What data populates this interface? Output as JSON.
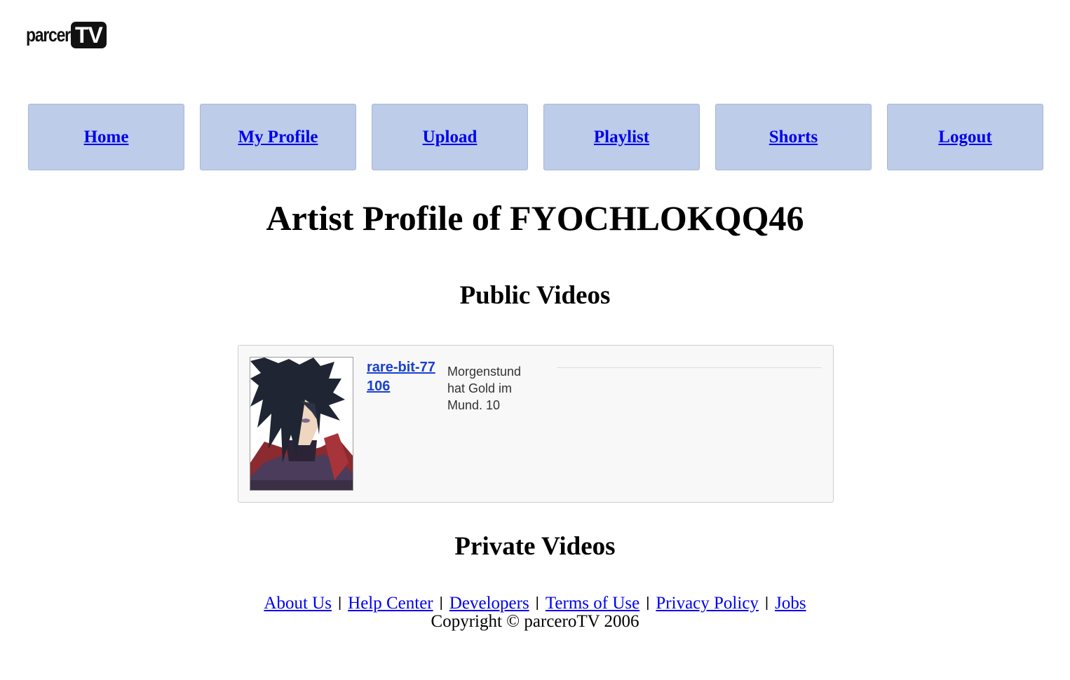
{
  "logo": {
    "word": "parcero",
    "badge": "TV"
  },
  "nav": {
    "items": [
      {
        "label": "Home"
      },
      {
        "label": "My Profile"
      },
      {
        "label": "Upload"
      },
      {
        "label": "Playlist"
      },
      {
        "label": "Shorts"
      },
      {
        "label": "Logout"
      }
    ]
  },
  "page": {
    "title": "Artist Profile of FYOCHLOKQQ46"
  },
  "public_videos": {
    "heading": "Public Videos",
    "items": [
      {
        "title": "rare-bit-77106",
        "description": "Morgenstund hat Gold im Mund. 10"
      }
    ]
  },
  "private_videos": {
    "heading": "Private Videos"
  },
  "footer": {
    "links": [
      {
        "label": "About Us"
      },
      {
        "label": "Help Center"
      },
      {
        "label": "Developers"
      },
      {
        "label": "Terms of Use"
      },
      {
        "label": "Privacy Policy"
      },
      {
        "label": "Jobs"
      }
    ],
    "separator": "|",
    "copyright": "Copyright © parceroTV 2006"
  },
  "colors": {
    "nav_bg": "#bccce9",
    "link": "#0000ee",
    "card_bg": "#f8f8f8"
  }
}
